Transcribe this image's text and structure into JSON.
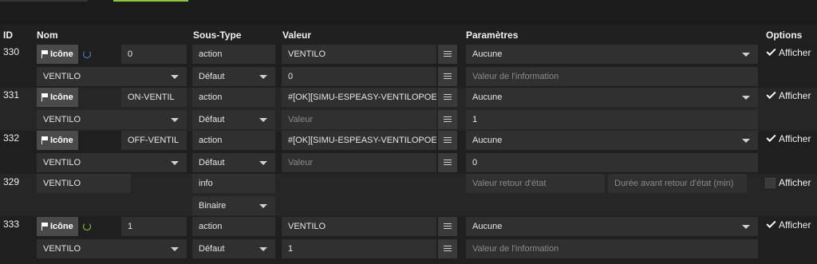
{
  "headers": {
    "id": "ID",
    "nom": "Nom",
    "soustype": "Sous-Type",
    "valeur": "Valeur",
    "parametres": "Paramètres",
    "options": "Options"
  },
  "icon_label": "Icône",
  "afficher_label": "Afficher",
  "colors": {
    "bg": "#202020",
    "field": "#303030",
    "accent_green": "#8cc63f",
    "refresh_blue": "#4f8fd9"
  },
  "rows": [
    {
      "id": "330",
      "icon_value": "0",
      "name": "VENTILO",
      "subtype": "action",
      "subtype2": "Défaut",
      "valeur": "VENTILO",
      "valeur2": "0",
      "param": "Aucune",
      "param2_placeholder": "Valeur de l'information",
      "afficher_checked": true
    },
    {
      "id": "331",
      "icon_value": "ON-VENTIL",
      "name": "VENTILO",
      "subtype": "action",
      "subtype2": "Défaut",
      "valeur": "#[OK][SIMU-ESPEASY-VENTILOPOELE][(",
      "valeur2_placeholder": "Valeur",
      "param": "Aucune",
      "param2": "1",
      "afficher_checked": true
    },
    {
      "id": "332",
      "icon_value": "OFF-VENTIL",
      "name": "VENTILO",
      "subtype": "action",
      "subtype2": "Défaut",
      "valeur": "#[OK][SIMU-ESPEASY-VENTILOPOELE][(",
      "valeur2_placeholder": "Valeur",
      "param": "Aucune",
      "param2": "0",
      "afficher_checked": true
    },
    {
      "id": "329",
      "name": "VENTILO",
      "subtype": "info",
      "subtype2": "Binaire",
      "param_placeholder_a": "Valeur retour d'état",
      "param_placeholder_b": "Durée avant retour d'état (min)",
      "afficher_checked": false
    },
    {
      "id": "333",
      "icon_value": "1",
      "name": "VENTILO",
      "subtype": "action",
      "subtype2": "Défaut",
      "valeur": "VENTILO",
      "valeur2": "1",
      "param": "Aucune",
      "param2_placeholder": "Valeur de l'information",
      "afficher_checked": true
    }
  ]
}
